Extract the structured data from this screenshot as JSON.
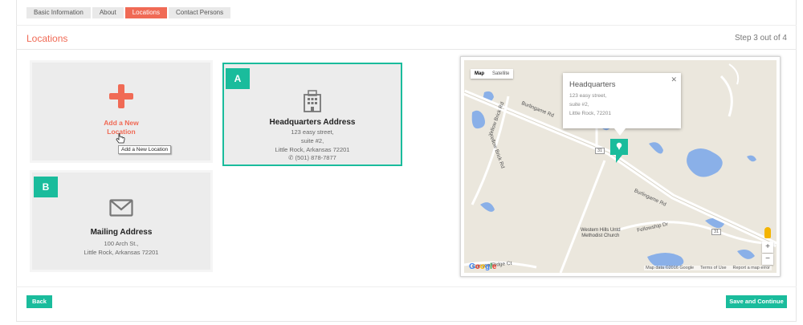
{
  "tabs": [
    {
      "label": "Basic Information"
    },
    {
      "label": "About"
    },
    {
      "label": "Locations"
    },
    {
      "label": "Contact Persons"
    }
  ],
  "page": {
    "title": "Locations",
    "step": "Step 3 out of 4"
  },
  "add_card": {
    "label_line1": "Add a New",
    "label_line2": "Location",
    "tooltip": "Add a New Location"
  },
  "locations": [
    {
      "badge": "A",
      "name": "Headquarters Address",
      "lines": [
        "123 easy street,",
        "suite #2,",
        "Little Rock, Arkansas 72201"
      ],
      "phone": "(501) 878-7877"
    },
    {
      "badge": "B",
      "name": "Mailing Address",
      "lines": [
        "100 Arch St.,",
        "Little Rock, Arkansas 72201"
      ]
    }
  ],
  "map": {
    "types": [
      "Map",
      "Satellite"
    ],
    "infowindow": {
      "title": "Headquarters",
      "lines": [
        "123 easy street,",
        "suite #2,",
        "Little Rock, 72201"
      ]
    },
    "roads": {
      "burlingame1": "Burlingame Rd",
      "burlingame2": "Burlingame Rd",
      "yellow1": "Yellow Brick Rd",
      "yellow2": "Yellow Brick Rd",
      "fellowship": "Fellowship Dr",
      "canyon": "Canyon Ridge Ct",
      "r31a": "31",
      "r31b": "31"
    },
    "poi": {
      "line1": "Western Hills Untd",
      "line2": "Methodist Church"
    },
    "footer": {
      "data": "Map data ©2016 Google",
      "terms": "Terms of Use",
      "report": "Report a map error"
    },
    "zoom_in": "+",
    "zoom_out": "−"
  },
  "colors": {
    "accent": "#1abc9c",
    "active_tab": "#f06a55",
    "water": "#8ab0e8"
  },
  "buttons": {
    "back": "Back",
    "save": "Save and Continue"
  }
}
